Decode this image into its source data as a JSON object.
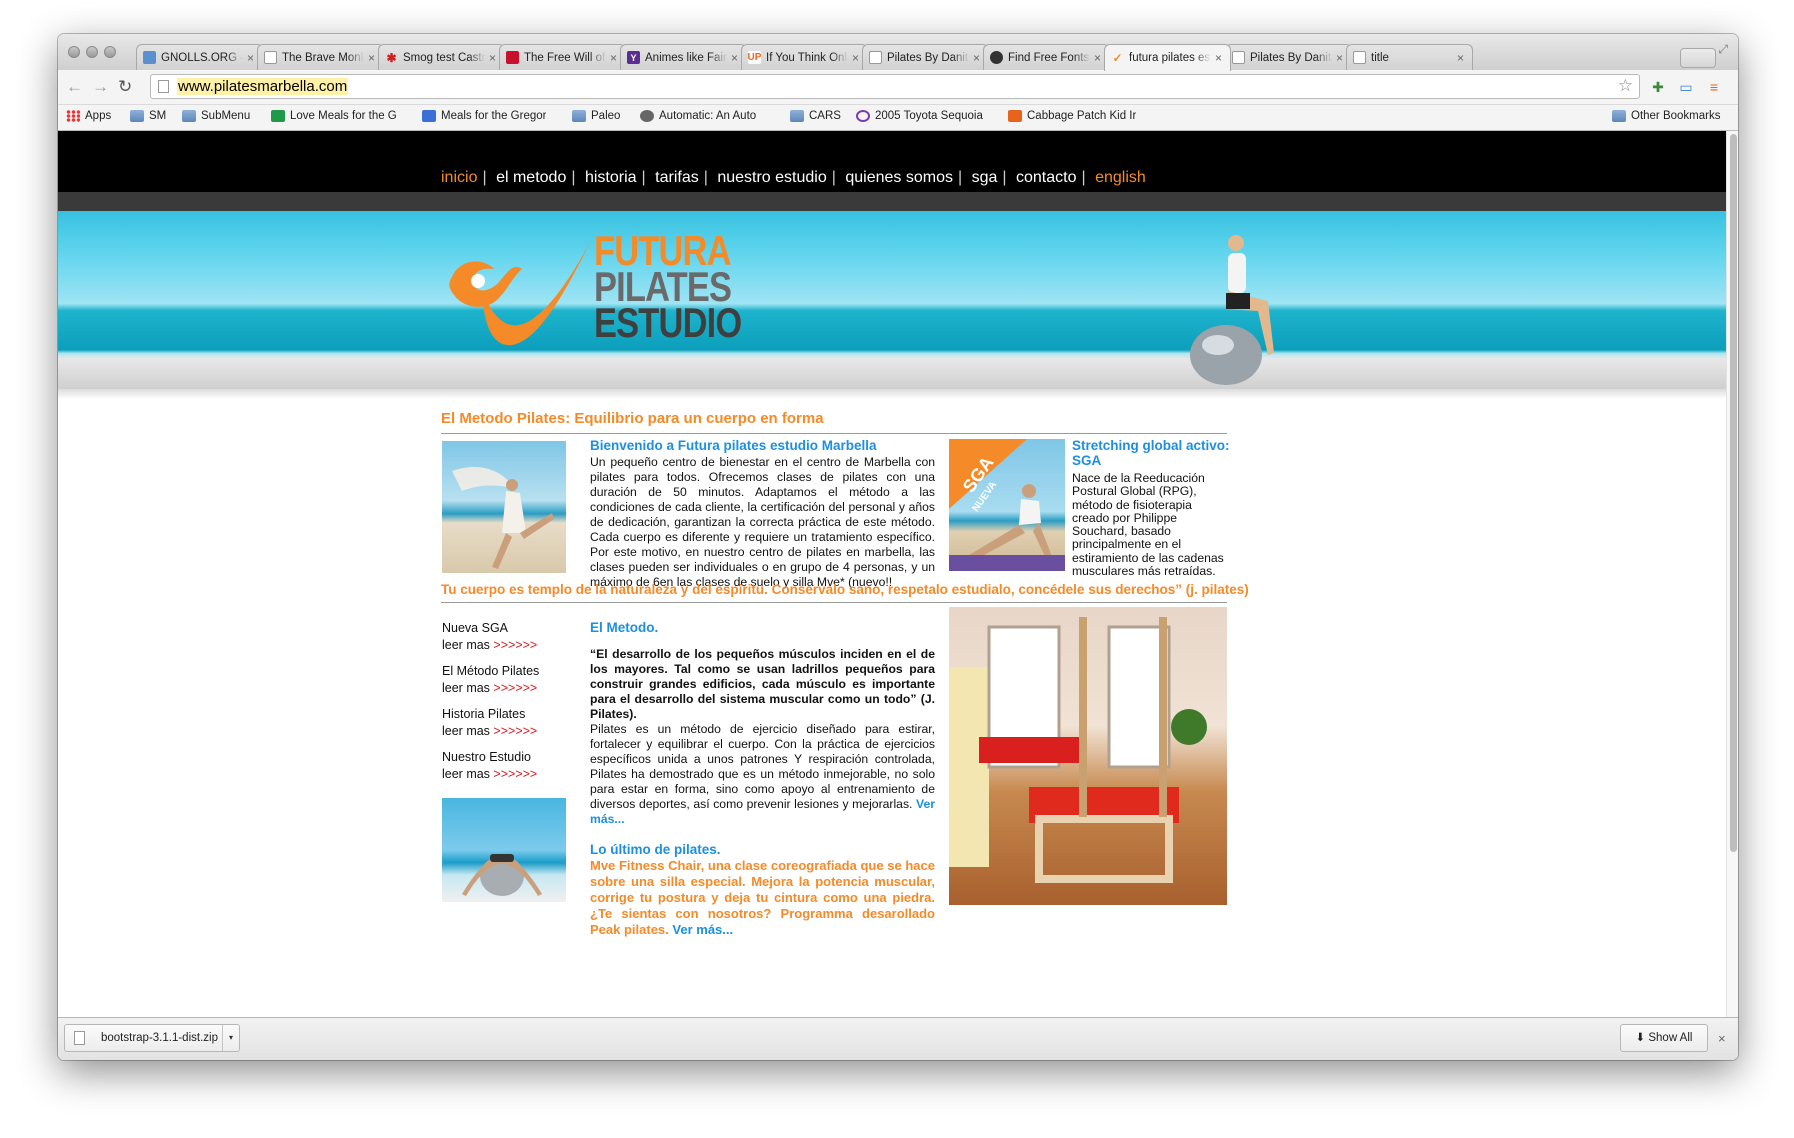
{
  "browser": {
    "tabs": [
      {
        "title": "GNOLLS.ORG – I",
        "favicon_color": "#5a8fd0"
      },
      {
        "title": "The Brave Monke",
        "favicon_color": "#ffffff"
      },
      {
        "title": "Smog test Castro",
        "favicon_color": "#d02020"
      },
      {
        "title": "The Free Will of",
        "favicon_color": "#c8102e"
      },
      {
        "title": "Animes like Fairy",
        "favicon_color": "#5b2d91",
        "favicon_glyph": "Y"
      },
      {
        "title": "If You Think Onl",
        "favicon_color": "#f26522",
        "favicon_glyph": "UP"
      },
      {
        "title": "Pilates By Danita",
        "favicon_color": "#ffffff"
      },
      {
        "title": "Find Free Fonts",
        "favicon_color": "#333333"
      },
      {
        "title": "futura pilates es",
        "favicon_color": "#f58a28",
        "active": true
      },
      {
        "title": "Pilates By Danita",
        "favicon_color": "#ffffff"
      },
      {
        "title": "title",
        "favicon_color": "#ffffff"
      }
    ],
    "url": "www.pilatesmarbella.com",
    "bookmarks": [
      {
        "label": "Apps",
        "icon": "apps-grid-icon"
      },
      {
        "label": "SM",
        "icon": "folder-icon"
      },
      {
        "label": "SubMenu",
        "icon": "folder-icon"
      },
      {
        "label": "Love Meals for the G",
        "icon": "sheet-icon"
      },
      {
        "label": "Meals for the Gregor",
        "icon": "doc-icon"
      },
      {
        "label": "Paleo",
        "icon": "folder-icon"
      },
      {
        "label": "Automatic: An Auto",
        "icon": "site-icon"
      },
      {
        "label": "CARS",
        "icon": "folder-icon"
      },
      {
        "label": "2005 Toyota Sequoia",
        "icon": "peace-icon"
      },
      {
        "label": "Cabbage Patch Kid Ir",
        "icon": "etsy-icon"
      }
    ],
    "other_bookmarks": "Other Bookmarks"
  },
  "site": {
    "nav": [
      "inicio",
      "el metodo",
      "historia",
      "tarifas",
      "nuestro estudio",
      "quienes somos",
      "sga",
      "contacto",
      "english"
    ],
    "logo": {
      "line1": "FUTURA",
      "line2": "PILATES",
      "line3": "ESTUDIO"
    },
    "section1_title": "El Metodo Pilates: Equilibrio para un cuerpo en forma",
    "welcome": {
      "title": "Bienvenido a Futura pilates estudio Marbella",
      "body": "Un pequeño centro de bienestar en el centro de Marbella con pilates para todos. Ofrecemos clases de pilates con una duración de 50 minutos. Adaptamos el método a las condiciones de cada cliente, la certificación del personal y años de dedicación, garantizan la correcta práctica de este método. Cada cuerpo es diferente y requiere un tratamiento específico. Por este motivo, en nuestro centro de pilates en marbella, las clases pueden ser individuales o en grupo de 4 personas, y un máximo de 6en las clases de suelo y silla Mve* (nuevo!!"
    },
    "sga": {
      "badge": "SGA NUEVA",
      "title": "Stretching global activo: SGA",
      "body": "Nace de la Reeducación Postural Global (RPG), método de fisioterapia creado por Philippe Souchard, basado principalmente en el estiramiento de las cadenas musculares más retraídas."
    },
    "quote_title": "Tu cuerpo es templo de la naturaleza y del espiritu. Conservalo sano, respetalo estudialo, concédele sus derechos” (j. pilates)",
    "side_links": [
      {
        "label": "Nueva SGA",
        "more": "leer mas",
        "arrows": ">>>>>>"
      },
      {
        "label": "El Método Pilates",
        "more": "leer mas",
        "arrows": ">>>>>>"
      },
      {
        "label": "Historia Pilates",
        "more": "leer mas",
        "arrows": ">>>>>>"
      },
      {
        "label": "Nuestro Estudio",
        "more": "leer mas",
        "arrows": ">>>>>>"
      }
    ],
    "metodo": {
      "title": "El Metodo.",
      "quote": "“El desarrollo de los pequeños músculos inciden en el de los mayores. Tal como se usan ladrillos pequeños para construir grandes edificios, cada músculo es importante para el desarrollo del sistema muscular como un todo” (J. Pilates).",
      "body": "Pilates es un método de ejercicio diseñado para estirar, fortalecer y equilibrar el cuerpo. Con la práctica de ejercicios específicos unida a unos patrones Y respiración controlada, Pilates ha demostrado que es un método inmejorable, no solo para estar en forma, sino como apoyo al entrenamiento de diversos deportes, así como prevenir lesiones y mejorarlas.",
      "more": "Ver más..."
    },
    "latest": {
      "title": "Lo último de pilates.",
      "body": "Mve Fitness Chair, una clase coreografiada que se hace sobre una silla especial. Mejora la potencia muscular, corrige tu postura y deja tu cintura como una piedra. ¿Te sientas con nosotros? Programma desarollado Peak pilates.",
      "more": "Ver más..."
    }
  },
  "downloads": {
    "file": "bootstrap-3.1.1-dist.zip",
    "show_all": "Show All"
  },
  "colors": {
    "accent_orange": "#f58a28",
    "link_blue": "#1e8fe0",
    "arrow_red": "#e0141e"
  }
}
